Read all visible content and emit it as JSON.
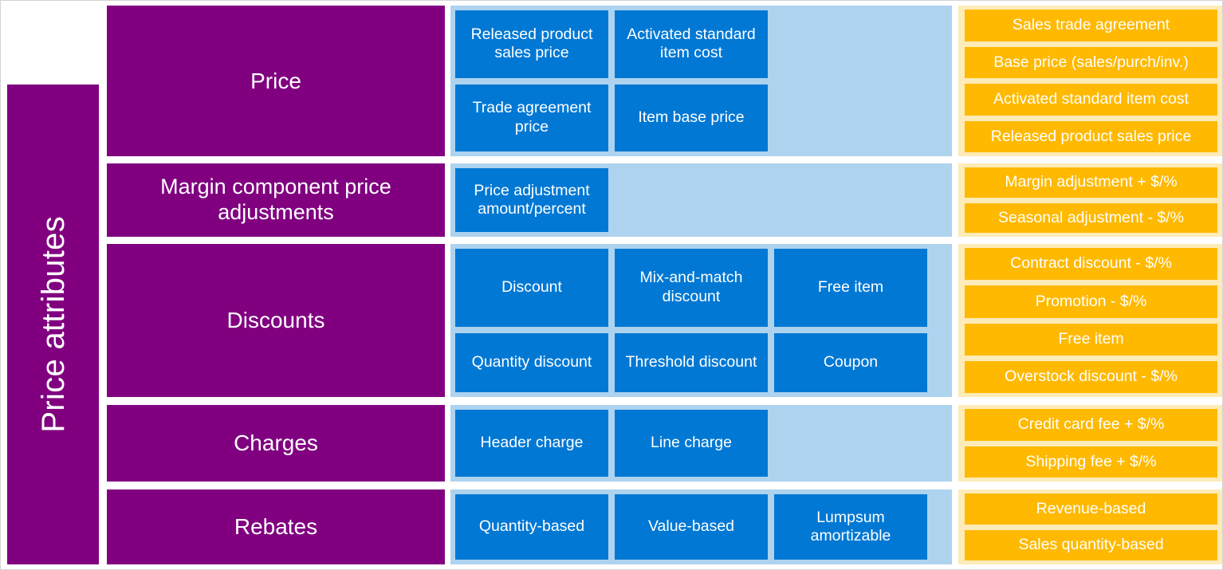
{
  "title": "Price attributes",
  "colors": {
    "purple": "#800080",
    "blue": "#0078D4",
    "light_blue": "#AED3EF",
    "gold": "#FFB900",
    "pale_gold": "#FDEBB8",
    "white": "#FFFFFF"
  },
  "rows": [
    {
      "category": "Price",
      "blue_rows": [
        [
          "Released product sales price",
          "Activated standard item cost",
          ""
        ],
        [
          "Trade agreement price",
          "Item base price",
          ""
        ]
      ],
      "gold_items": [
        "Sales trade agreement",
        "Base price (sales/purch/inv.)",
        "Activated standard item cost",
        "Released product sales price"
      ]
    },
    {
      "category": "Margin component price adjustments",
      "blue_rows": [
        [
          "Price adjustment amount/percent",
          "",
          ""
        ]
      ],
      "gold_items": [
        "Margin adjustment + $/%",
        "Seasonal adjustment - $/%"
      ]
    },
    {
      "category": "Discounts",
      "blue_rows": [
        [
          "Discount",
          "Mix-and-match discount",
          "Free item"
        ],
        [
          "Quantity discount",
          "Threshold discount",
          "Coupon"
        ]
      ],
      "gold_items": [
        "Contract discount - $/%",
        "Promotion - $/%",
        "Free item",
        "Overstock discount - $/%"
      ]
    },
    {
      "category": "Charges",
      "blue_rows": [
        [
          "Header charge",
          "Line charge",
          ""
        ]
      ],
      "gold_items": [
        "Credit card fee + $/%",
        "Shipping fee + $/%"
      ]
    },
    {
      "category": "Rebates",
      "blue_rows": [
        [
          "Quantity-based",
          "Value-based",
          "Lumpsum amortizable"
        ]
      ],
      "gold_items": [
        "Revenue-based",
        "Sales quantity-based"
      ]
    }
  ]
}
